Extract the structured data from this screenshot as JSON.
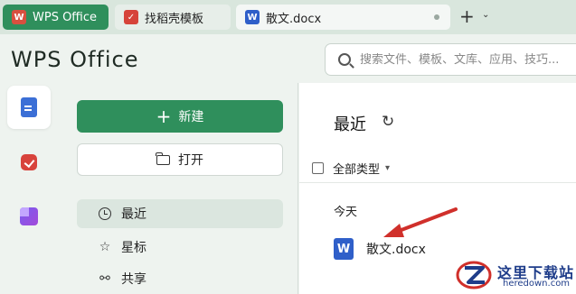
{
  "tabs": [
    {
      "label": "WPS Office"
    },
    {
      "label": "找稻壳模板"
    },
    {
      "label": "散文.docx"
    }
  ],
  "header": {
    "logo": "WPS Office",
    "search_placeholder": "搜索文件、模板、文库、应用、技巧..."
  },
  "rail": {
    "items": [
      "document-icon",
      "daoke-icon",
      "apps-icon"
    ]
  },
  "nav": {
    "new_label": "新建",
    "open_label": "打开",
    "items": [
      {
        "label": "最近",
        "icon": "clock-icon",
        "selected": true
      },
      {
        "label": "星标",
        "icon": "star-icon",
        "selected": false
      },
      {
        "label": "共享",
        "icon": "share-icon",
        "selected": false
      }
    ]
  },
  "main": {
    "title": "最近",
    "filter_label": "全部类型",
    "group_today": "今天",
    "files": [
      {
        "name": "散文.docx",
        "icon": "word-doc-icon"
      }
    ]
  },
  "watermark": {
    "title": "这里下载站",
    "url": "heredown.com"
  },
  "colors": {
    "accent": "#2f8f5c",
    "word_blue": "#2f5fc9",
    "arrow_red": "#d0302b"
  }
}
